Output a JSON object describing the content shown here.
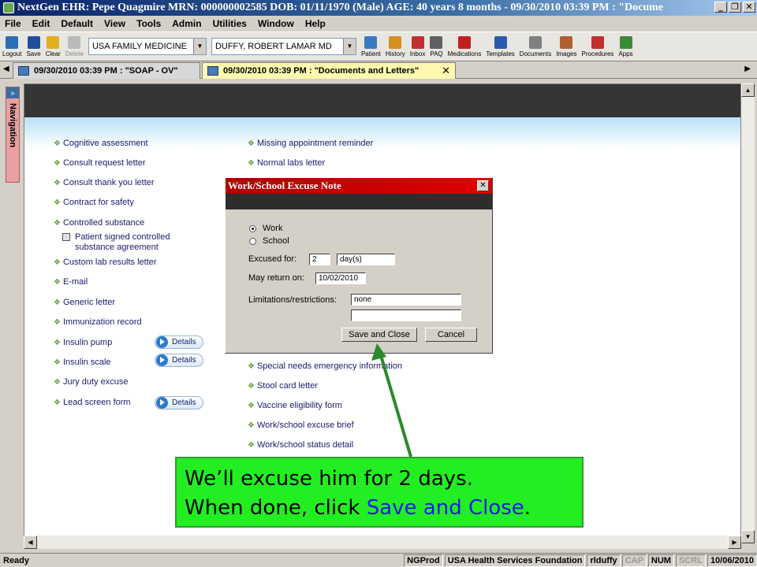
{
  "window": {
    "title": "NextGen EHR: Pepe Quagmire  MRN: 000000002585  DOB: 01/11/1970  (Male)  AGE: 40 years 8 months - 09/30/2010 03:39 PM : \"Docume"
  },
  "menu": [
    "File",
    "Edit",
    "Default",
    "View",
    "Tools",
    "Admin",
    "Utilities",
    "Window",
    "Help"
  ],
  "toolbar": {
    "left_buttons": [
      {
        "label": "Logout",
        "icon": "logout-icon",
        "color": "#2a6fb5"
      },
      {
        "label": "Save",
        "icon": "save-icon",
        "color": "#1f4f9a"
      },
      {
        "label": "Clear",
        "icon": "clear-icon",
        "color": "#e0b020"
      },
      {
        "label": "Delete",
        "icon": "delete-icon",
        "color": "#aaaaaa"
      }
    ],
    "practice": "USA FAMILY MEDICINE",
    "provider": "DUFFY, ROBERT  LAMAR MD",
    "right_buttons": [
      {
        "label": "Patient",
        "icon": "patient-icon",
        "color": "#3a7ac0"
      },
      {
        "label": "History",
        "icon": "history-icon",
        "color": "#d49020"
      },
      {
        "label": "Inbox",
        "icon": "inbox-icon",
        "color": "#c03030"
      },
      {
        "label": "PAQ",
        "icon": "paq-icon",
        "color": "#606060"
      },
      {
        "label": "Medications",
        "icon": "rx-icon",
        "color": "#c02020"
      },
      {
        "label": "Templates",
        "icon": "templates-icon",
        "color": "#2a5ab0"
      },
      {
        "label": "Documents",
        "icon": "documents-icon",
        "color": "#808080"
      },
      {
        "label": "Images",
        "icon": "images-icon",
        "color": "#b06030"
      },
      {
        "label": "Procedures",
        "icon": "procedures-icon",
        "color": "#c03030"
      },
      {
        "label": "Apps",
        "icon": "apps-icon",
        "color": "#3a8a3a"
      }
    ]
  },
  "tabs": [
    {
      "label": "09/30/2010 03:39 PM : \"SOAP - OV\""
    },
    {
      "label": "09/30/2010 03:39 PM : \"Documents and Letters\"",
      "close": "✕"
    }
  ],
  "nav": {
    "label": "Navigation",
    "toggle": "»"
  },
  "letters": {
    "left": [
      "Cognitive assessment",
      "Consult request letter",
      "Consult thank you letter",
      "Contract for safety",
      "Controlled substance",
      "Custom lab results letter",
      "E-mail",
      "Generic letter",
      "Immunization record",
      "Insulin pump",
      "Insulin scale",
      "Jury duty excuse",
      "Lead screen form"
    ],
    "checkbox_label": "Patient signed controlled substance agreement",
    "right": [
      "Missing appointment reminder",
      "Normal labs letter",
      "Special needs emergency information",
      "Stool card letter",
      "Vaccine eligibility form",
      "Work/school excuse brief",
      "Work/school status detail"
    ],
    "details_label": "Details"
  },
  "dialog": {
    "title": "Work/School Excuse Note",
    "close": "✕",
    "options": [
      "Work",
      "School"
    ],
    "selected": "Work",
    "excused_label": "Excused  for:",
    "excused_value": "2",
    "unit_value": "day(s)",
    "return_label": "May return on:",
    "return_value": "10/02/2010",
    "limitations_label": "Limitations/restrictions:",
    "limitations_value": "none",
    "limitations_value2": "",
    "save_label": "Save and Close",
    "cancel_label": "Cancel"
  },
  "callout": {
    "line1": "We’ll excuse him for 2 days.",
    "line2_prefix": "When done, click ",
    "line2_highlight": "Save and Close",
    "line2_suffix": "."
  },
  "status": {
    "ready": "Ready",
    "cells": [
      "NGProd",
      "USA Health Services Foundation",
      "rlduffy",
      "CAP",
      "NUM",
      "SCRL",
      "10/06/2010"
    ]
  }
}
